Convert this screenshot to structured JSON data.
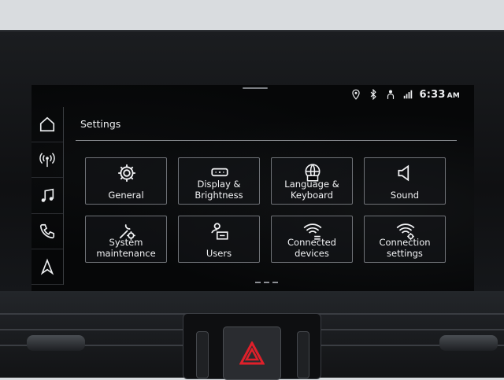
{
  "screen": {
    "title": "Settings",
    "status": {
      "time": "6:33",
      "ampm": "AM",
      "icons": [
        "location-pin-icon",
        "bluetooth-icon",
        "person-icon",
        "signal-icon"
      ]
    },
    "nav": [
      {
        "name": "home",
        "icon": "home-icon"
      },
      {
        "name": "radio",
        "icon": "radio-antenna-icon"
      },
      {
        "name": "media",
        "icon": "music-note-icon"
      },
      {
        "name": "phone",
        "icon": "phone-icon"
      },
      {
        "name": "navigation",
        "icon": "navigation-arrow-icon"
      }
    ],
    "tiles": [
      {
        "label": "General",
        "icon": "gear-icon"
      },
      {
        "label": "Display &\nBrightness",
        "icon": "display-icon"
      },
      {
        "label": "Language &\nKeyboard",
        "icon": "globe-keyboard-icon"
      },
      {
        "label": "Sound",
        "icon": "speaker-icon"
      },
      {
        "label": "System\nmaintenance",
        "icon": "wrench-gear-icon"
      },
      {
        "label": "Users",
        "icon": "user-card-icon"
      },
      {
        "label": "Connected\ndevices",
        "icon": "wifi-list-icon"
      },
      {
        "label": "Connection\nsettings",
        "icon": "wifi-gear-icon"
      }
    ],
    "pager_dots": 3
  },
  "colors": {
    "accent": "#f2f3f5",
    "hazard": "#e0202a"
  }
}
